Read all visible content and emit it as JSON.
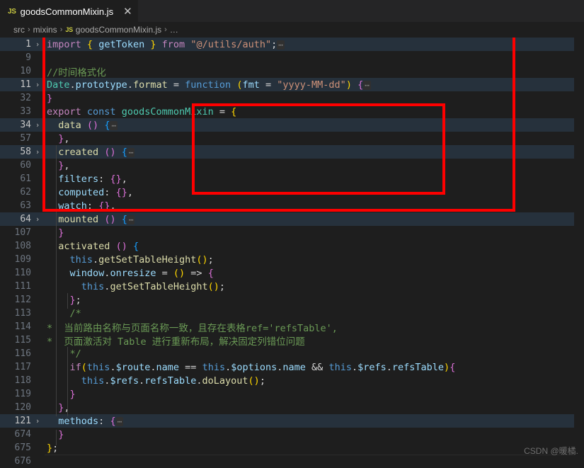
{
  "window": {
    "app": "Visual Studio Code",
    "theme_bg": "#1e1e1e",
    "accent_red": "#fe0000"
  },
  "tabbar": {
    "tabs": [
      {
        "file_icon_label": "JS",
        "label": "goodsCommonMixin.js",
        "close_label": "✕",
        "active": true
      }
    ]
  },
  "breadcrumb": {
    "items": [
      "src",
      "mixins",
      "goodsCommonMixin.js",
      "…"
    ],
    "file_icon_label": "JS",
    "separator": "›"
  },
  "editor": {
    "language": "JavaScript",
    "fold_open": "›",
    "folded_marker": "⋯",
    "lines": [
      {
        "num": "1",
        "fold": true,
        "hl": true,
        "indent": 0
      },
      {
        "num": "9",
        "fold": false,
        "hl": false,
        "indent": 0
      },
      {
        "num": "10",
        "fold": false,
        "hl": false,
        "indent": 0
      },
      {
        "num": "11",
        "fold": true,
        "hl": true,
        "indent": 0
      },
      {
        "num": "32",
        "fold": false,
        "hl": false,
        "indent": 0
      },
      {
        "num": "33",
        "fold": false,
        "hl": false,
        "indent": 0
      },
      {
        "num": "34",
        "fold": true,
        "hl": true,
        "indent": 1
      },
      {
        "num": "57",
        "fold": false,
        "hl": false,
        "indent": 1
      },
      {
        "num": "58",
        "fold": true,
        "hl": true,
        "indent": 1
      },
      {
        "num": "60",
        "fold": false,
        "hl": false,
        "indent": 1
      },
      {
        "num": "61",
        "fold": false,
        "hl": false,
        "indent": 1
      },
      {
        "num": "62",
        "fold": false,
        "hl": false,
        "indent": 1
      },
      {
        "num": "63",
        "fold": false,
        "hl": false,
        "indent": 1
      },
      {
        "num": "64",
        "fold": true,
        "hl": true,
        "indent": 1
      },
      {
        "num": "107",
        "fold": false,
        "hl": false,
        "indent": 1
      },
      {
        "num": "108",
        "fold": false,
        "hl": false,
        "indent": 1
      },
      {
        "num": "109",
        "fold": false,
        "hl": false,
        "indent": 2
      },
      {
        "num": "110",
        "fold": false,
        "hl": false,
        "indent": 2
      },
      {
        "num": "111",
        "fold": false,
        "hl": false,
        "indent": 3
      },
      {
        "num": "112",
        "fold": false,
        "hl": false,
        "indent": 2
      },
      {
        "num": "113",
        "fold": false,
        "hl": false,
        "indent": 2
      },
      {
        "num": "114",
        "fold": false,
        "hl": false,
        "indent": 2
      },
      {
        "num": "115",
        "fold": false,
        "hl": false,
        "indent": 2
      },
      {
        "num": "116",
        "fold": false,
        "hl": false,
        "indent": 2
      },
      {
        "num": "117",
        "fold": false,
        "hl": false,
        "indent": 2
      },
      {
        "num": "118",
        "fold": false,
        "hl": false,
        "indent": 3
      },
      {
        "num": "119",
        "fold": false,
        "hl": false,
        "indent": 2
      },
      {
        "num": "120",
        "fold": false,
        "hl": false,
        "indent": 1
      },
      {
        "num": "121",
        "fold": true,
        "hl": true,
        "indent": 1
      },
      {
        "num": "674",
        "fold": false,
        "hl": false,
        "indent": 1
      },
      {
        "num": "675",
        "fold": false,
        "hl": false,
        "indent": 0
      },
      {
        "num": "676",
        "fold": false,
        "hl": false,
        "indent": 0
      }
    ],
    "code_text": {
      "l1": "import { getToken } from \"@/utils/auth\";",
      "l9": "",
      "l10": "//时间格式化",
      "l11": "Date.prototype.format = function (fmt = \"yyyy-MM-dd\") {",
      "l32": "}",
      "l33": "export const goodsCommonMixin = {",
      "l34": "data () {",
      "l57": "},",
      "l58": "created () {",
      "l60": "},",
      "l61": "filters: {},",
      "l62": "computed: {},",
      "l63": "watch: {},",
      "l64": "mounted () {",
      "l107": "}",
      "l108": "activated () {",
      "l109": "this.getSetTableHeight();",
      "l110": "window.onresize = () => {",
      "l111": "this.getSetTableHeight();",
      "l112": "};",
      "l113": "/*",
      "l114": "*  当前路由名称与页面名称一致，且存在表格ref='refsTable',",
      "l115": "*  页面激活对 Table 进行重新布局，解决固定列错位问题",
      "l116": "*/",
      "l117": "if(this.$route.name == this.$options.name && this.$refs.refsTable){",
      "l118": "this.$refs.refsTable.doLayout();",
      "l119": "}",
      "l120": "},",
      "l121": "methods: {",
      "l674": "}",
      "l675": "};",
      "l676": ""
    }
  },
  "annotations": {
    "outer_box": {
      "label": "activated-hook-highlight"
    },
    "inner_box": {
      "label": "comment-and-condition-highlight"
    }
  },
  "watermark": {
    "text": "CSDN @暖橘."
  }
}
